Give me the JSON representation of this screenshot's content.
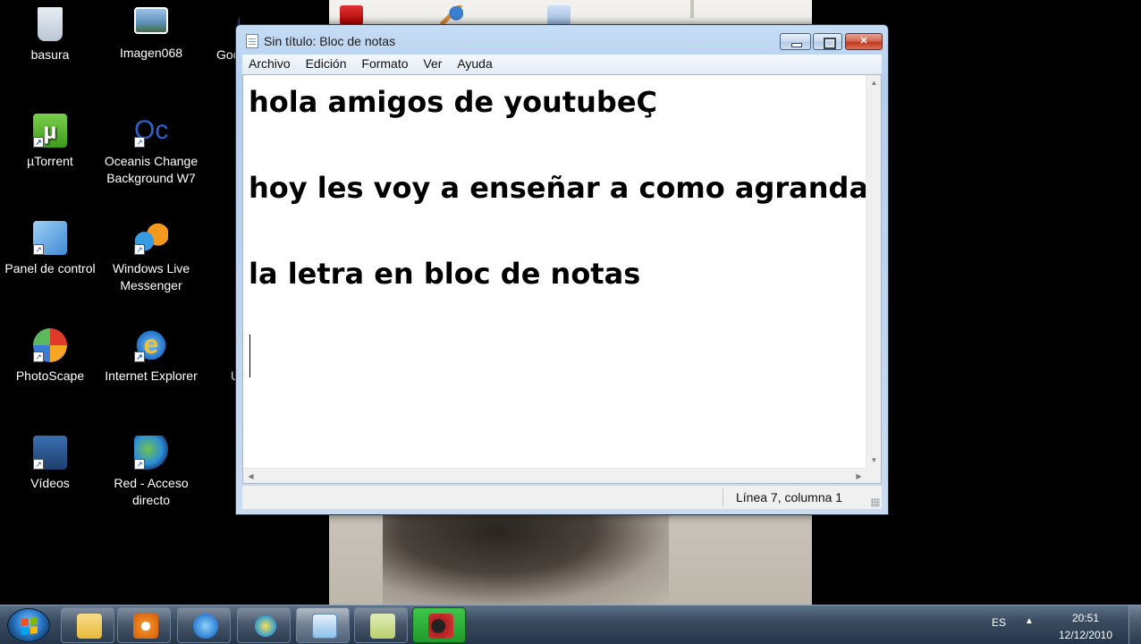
{
  "desktop": {
    "icons": [
      {
        "label": "basura",
        "icon": "recycle-bin-icon"
      },
      {
        "label": "Imagen068",
        "icon": "image-file-icon"
      },
      {
        "label": "Goo",
        "icon": "google-earth-icon"
      },
      {
        "label": "µTorrent",
        "icon": "utorrent-icon"
      },
      {
        "label": "Oceanis Change Background W7",
        "icon": "oceanis-icon"
      },
      {
        "label": "Panel de control",
        "icon": "control-panel-icon"
      },
      {
        "label": "Windows Live Messenger",
        "icon": "messenger-icon"
      },
      {
        "label": "PhotoScape",
        "icon": "photoscape-icon"
      },
      {
        "label": "Internet Explorer",
        "icon": "internet-explorer-icon"
      },
      {
        "label": "U",
        "icon": "partial-icon"
      },
      {
        "label": "Vídeos",
        "icon": "videos-icon"
      },
      {
        "label": "Red - Acceso directo",
        "icon": "network-icon"
      }
    ]
  },
  "notepad": {
    "title": "Sin título: Bloc de notas",
    "menu": [
      "Archivo",
      "Edición",
      "Formato",
      "Ver",
      "Ayuda"
    ],
    "lines": [
      "hola amigos de youtubeÇ",
      "",
      "hoy les voy a enseñar a como agrandar",
      "",
      "la letra en bloc de notas",
      "",
      ""
    ],
    "status": "Línea 7, columna 1",
    "buttons": {
      "minimize": "minimize-button",
      "maximize": "maximize-button",
      "close": "close-button"
    }
  },
  "taskbar": {
    "apps": [
      {
        "name": "explorer",
        "icon": "folder-icon"
      },
      {
        "name": "media-player",
        "icon": "media-player-icon"
      },
      {
        "name": "internet-explorer",
        "icon": "internet-explorer-icon"
      },
      {
        "name": "avant",
        "icon": "avant-browser-icon"
      },
      {
        "name": "notepad",
        "icon": "notepad-icon"
      },
      {
        "name": "notes",
        "icon": "sticky-notes-icon"
      },
      {
        "name": "recorder",
        "icon": "camera-recorder-icon"
      }
    ],
    "language": "ES",
    "time": "20:51",
    "date": "12/12/2010"
  },
  "colors": {
    "window_frame": "#b4cfee",
    "close_button": "#c2391f",
    "taskbar": "#3a4b60"
  }
}
